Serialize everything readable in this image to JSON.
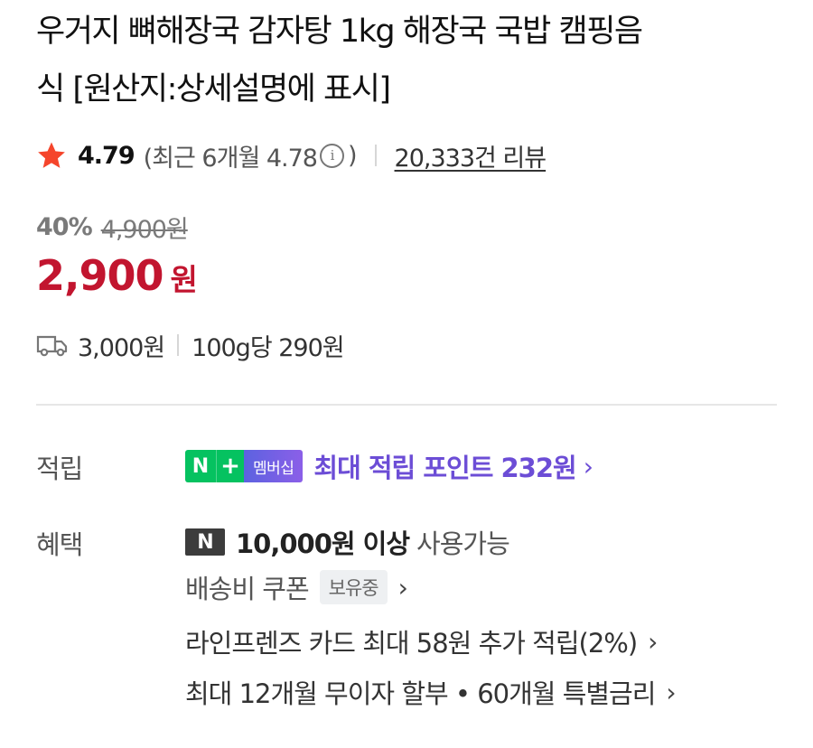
{
  "product": {
    "title_line1": "우거지 뼈해장국 감자탕 1kg 해장국 국밥 캠핑음",
    "title_line2": "식 [원산지:상세설명에 표시]"
  },
  "rating": {
    "score": "4.79",
    "recent_open": "(최근 6개월 4.78",
    "recent_close": ")",
    "info_glyph": "i",
    "review_count": "20,333건 리뷰",
    "star_color": "#f5452b"
  },
  "price": {
    "discount_rate": "40%",
    "original": "4,900원",
    "sale_value": "2,900",
    "sale_unit": "원",
    "sale_color": "#c2152f"
  },
  "shipping": {
    "icon": "truck-icon",
    "fee": "3,000원",
    "unit_price": "100g당 290원"
  },
  "points": {
    "label": "적립",
    "badge_n": "N",
    "badge_plus": "+",
    "badge_member": "멤버십",
    "text": "최대 적립 포인트 232원",
    "chevron": "›"
  },
  "benefits": {
    "label": "혜택",
    "npay_icon_text": "N",
    "npay_min": "10,000원 이상",
    "npay_usage": "사용가능",
    "shipping_coupon": "배송비 쿠폰",
    "owned_badge": "보유중",
    "card_text": "라인프렌즈 카드 최대 58원 추가 적립(2%)",
    "installment_text": "최대 12개월 무이자 할부 • 60개월 특별금리",
    "chevron": "›"
  }
}
